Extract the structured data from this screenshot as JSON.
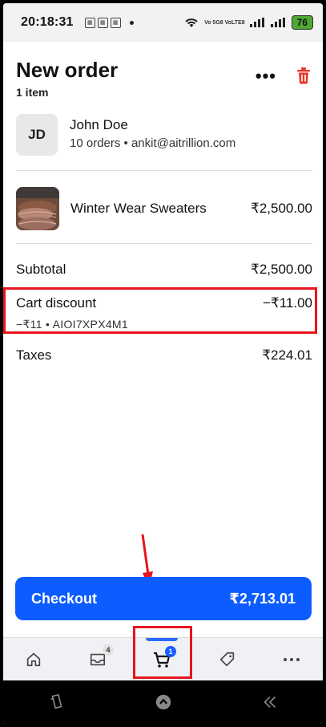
{
  "status_bar": {
    "time": "20:18:31",
    "battery": "76",
    "network_label": "Vo 5G8 VoLTE8"
  },
  "header": {
    "title": "New order",
    "item_count": "1 item",
    "more_label": "•••"
  },
  "customer": {
    "initials": "JD",
    "name": "John Doe",
    "meta": "10 orders • ankit@aitrillion.com"
  },
  "product": {
    "name": "Winter Wear Sweaters",
    "price": "₹2,500.00"
  },
  "totals": {
    "subtotal_label": "Subtotal",
    "subtotal_value": "₹2,500.00",
    "discount_label": "Cart discount",
    "discount_value": "−₹11.00",
    "discount_detail": "−₹11 • AIOI7XPX4M1",
    "taxes_label": "Taxes",
    "taxes_value": "₹224.01"
  },
  "checkout": {
    "label": "Checkout",
    "amount": "₹2,713.01"
  },
  "bottom_nav": {
    "items": [
      {
        "name": "home",
        "icon": "home-icon"
      },
      {
        "name": "orders",
        "icon": "orders-inbox-icon",
        "badge": "4"
      },
      {
        "name": "cart",
        "icon": "cart-icon",
        "badge": "1",
        "active": true
      },
      {
        "name": "tags",
        "icon": "tag-icon"
      },
      {
        "name": "more",
        "icon": "more-icon"
      }
    ]
  },
  "colors": {
    "accent": "#0c5cff",
    "highlight": "#e8141e",
    "delete": "#e5392d"
  }
}
